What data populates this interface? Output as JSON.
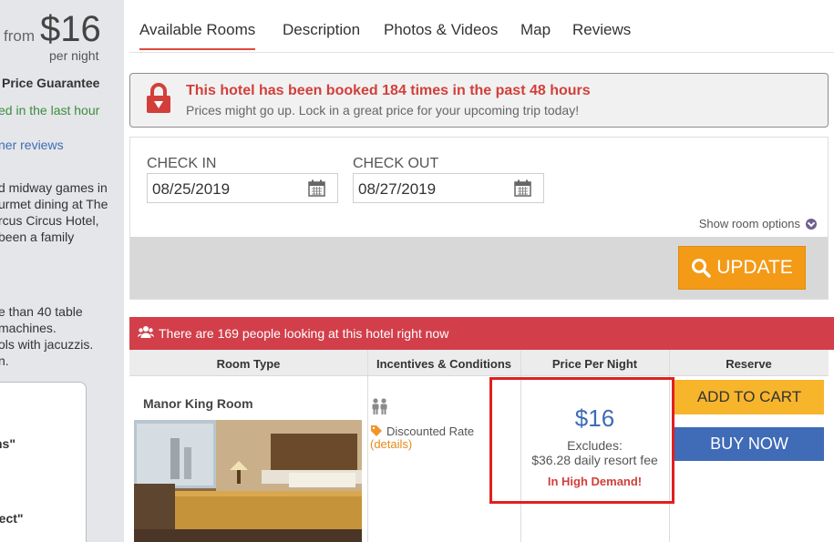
{
  "sidebar": {
    "from_label": "from",
    "price": "$16",
    "per_night": "per night",
    "guarantee": "Price Guarantee",
    "booked_last_hour": "ed in the last hour",
    "other_reviews": "ner reviews",
    "description_lines": [
      "d midway games in",
      "urmet dining at The",
      "rcus Circus Hotel,",
      "been a family"
    ],
    "description2_lines": [
      "e than 40 table",
      "machines.",
      "ols with jacuzzis.",
      "n."
    ],
    "quote1": "ns\"",
    "quote2": "fect\""
  },
  "tabs": [
    {
      "label": "Available Rooms"
    },
    {
      "label": "Description"
    },
    {
      "label": "Photos & Videos"
    },
    {
      "label": "Map"
    },
    {
      "label": "Reviews"
    }
  ],
  "alert": {
    "title": "This hotel has been booked 184 times in the past 48 hours",
    "subtitle": "Prices might go up. Lock in a great price for your upcoming trip today!"
  },
  "booking": {
    "check_in_label": "CHECK IN",
    "check_in_value": "08/25/2019",
    "check_out_label": "CHECK OUT",
    "check_out_value": "08/27/2019",
    "room_options": "Show room options",
    "update_label": "UPDATE"
  },
  "demand": {
    "text": "There are 169 people looking at this hotel right now"
  },
  "table": {
    "headers": [
      "Room Type",
      "Incentives & Conditions",
      "Price Per Night",
      "Reserve"
    ],
    "room": {
      "name": "Manor King Room",
      "incentive": "Discounted Rate",
      "details": "(details)",
      "price": "$16",
      "excludes_label": "Excludes:",
      "fee": "$36.28 daily resort fee",
      "demand_badge": "In High Demand!",
      "add_to_cart": "ADD TO CART",
      "buy_now": "BUY NOW"
    }
  },
  "colors": {
    "accent_red": "#d23f4a",
    "update_orange": "#f39a17",
    "cart_yellow": "#f7b52c",
    "buy_blue": "#3f6bb7",
    "price_blue": "#3d6db5"
  }
}
